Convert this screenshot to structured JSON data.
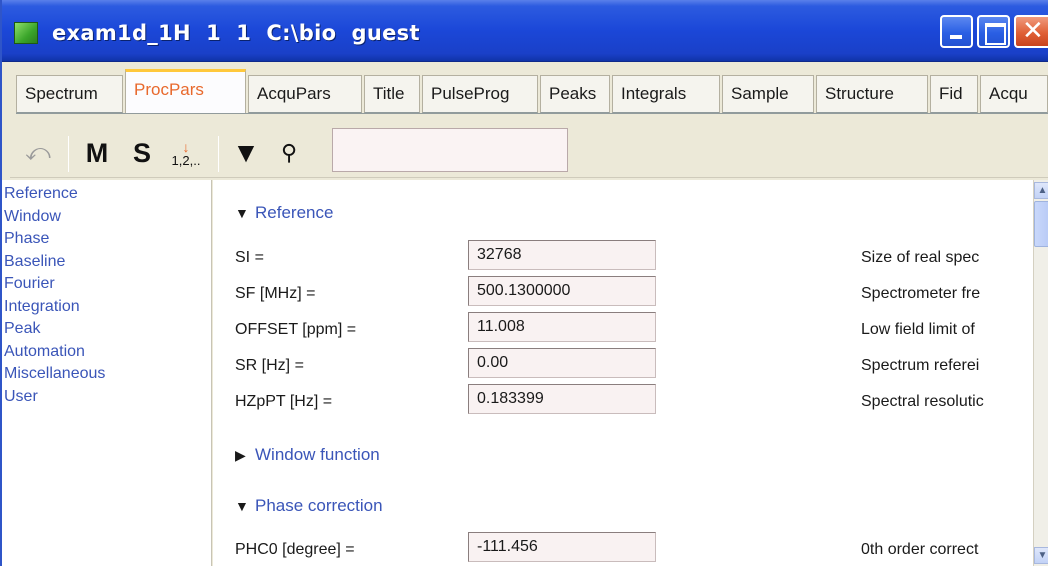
{
  "window": {
    "title": "exam1d_1H  1  1  C:\\bio  guest",
    "app_icon": "topspin-icon",
    "controls": [
      "minimize-icon",
      "maximize-icon",
      "close-icon"
    ]
  },
  "tabs": [
    {
      "label": "Spectrum",
      "active": false
    },
    {
      "label": "ProcPars",
      "active": true
    },
    {
      "label": "AcquPars",
      "active": false
    },
    {
      "label": "Title",
      "active": false
    },
    {
      "label": "PulseProg",
      "active": false
    },
    {
      "label": "Peaks",
      "active": false
    },
    {
      "label": "Integrals",
      "active": false
    },
    {
      "label": "Sample",
      "active": false
    },
    {
      "label": "Structure",
      "active": false
    },
    {
      "label": "Fid",
      "active": false
    },
    {
      "label": "Acqu",
      "active": false
    }
  ],
  "toolbar": {
    "undo_glyph": "⤺",
    "m_label": "M",
    "s_label": "S",
    "number_arrow": "↓",
    "number_label": "1,2,..",
    "filter_glyph": "▼",
    "find_glyph": "⚲",
    "search_value": ""
  },
  "sidebar": {
    "items": [
      "Reference",
      "Window",
      "Phase",
      "Baseline",
      "Fourier",
      "Integration",
      "Peak",
      "Automation",
      "Miscellaneous",
      "User"
    ]
  },
  "sections": {
    "reference": {
      "title": "Reference",
      "expanded_glyph": "▼",
      "params": [
        {
          "label": "SI =",
          "value": "32768",
          "desc": "Size of real spec"
        },
        {
          "label": "SF [MHz] =",
          "value": "500.1300000",
          "desc": "Spectrometer fre"
        },
        {
          "label": "OFFSET [ppm] =",
          "value": "11.008",
          "desc": "Low field limit of"
        },
        {
          "label": "SR [Hz] =",
          "value": "0.00",
          "desc": "Spectrum referei"
        },
        {
          "label": "HZpPT [Hz] =",
          "value": "0.183399",
          "desc": "Spectral resolutic"
        }
      ]
    },
    "window_function": {
      "title": "Window function",
      "collapsed_glyph": "▶"
    },
    "phase_correction": {
      "title": "Phase correction",
      "expanded_glyph": "▼",
      "params": [
        {
          "label": "PHC0 [degree] =",
          "value": "-111.456",
          "desc": "0th order correct"
        }
      ]
    }
  },
  "scrollbar": {
    "up_glyph": "▲",
    "down_glyph": "▼"
  }
}
